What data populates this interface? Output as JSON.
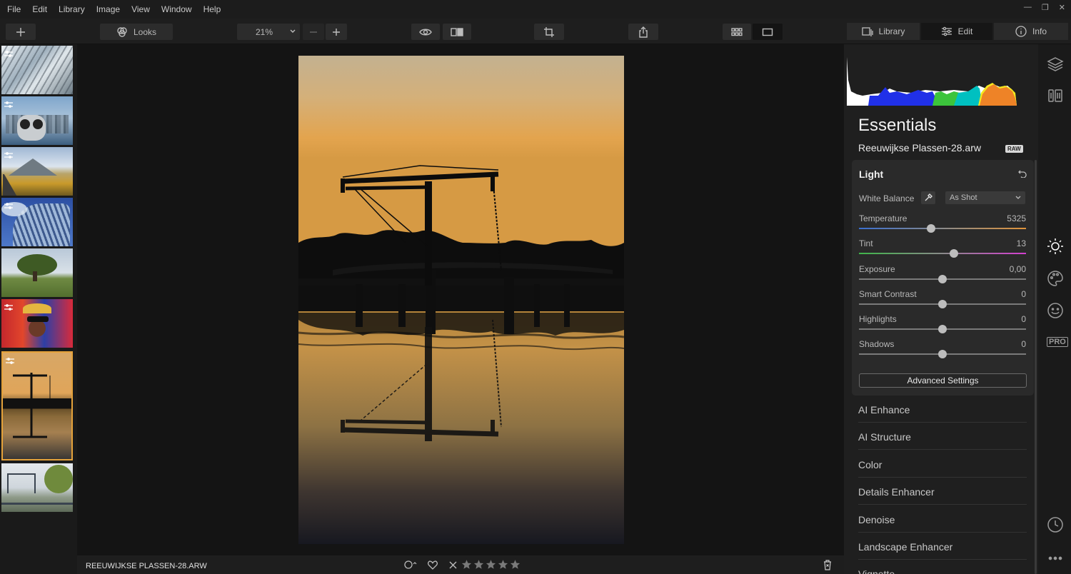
{
  "menu": [
    "File",
    "Edit",
    "Library",
    "Image",
    "View",
    "Window",
    "Help"
  ],
  "toolbar": {
    "looks_label": "Looks",
    "zoom_value": "21%"
  },
  "tabs": [
    {
      "label": "Library",
      "icon": "library-icon"
    },
    {
      "label": "Edit",
      "icon": "sliders-icon"
    },
    {
      "label": "Info",
      "icon": "info-icon"
    }
  ],
  "filmstrip": [
    {
      "subject": "architecture-lines",
      "edited": true
    },
    {
      "subject": "city-binoculars",
      "edited": true
    },
    {
      "subject": "mountain-road",
      "edited": true
    },
    {
      "subject": "glass-building",
      "edited": true
    },
    {
      "subject": "tree-field",
      "edited": false
    },
    {
      "subject": "carnival-portrait",
      "edited": true
    },
    {
      "subject": "bridge-sunset",
      "edited": true,
      "selected": true
    },
    {
      "subject": "harbor-bridge",
      "edited": false
    }
  ],
  "bottom": {
    "filename": "REEUWIJKSE PLASSEN-28.ARW",
    "rating_stars": 5
  },
  "panel": {
    "title": "Essentials",
    "file_name": "Reeuwijkse Plassen-28.arw",
    "raw_badge": "RAW",
    "light": {
      "title": "Light",
      "white_balance_label": "White Balance",
      "white_balance_value": "As Shot",
      "sliders": [
        {
          "label": "Temperature",
          "value": "5325",
          "position": 0.43
        },
        {
          "label": "Tint",
          "value": "13",
          "position": 0.57
        },
        {
          "label": "Exposure",
          "value": "0,00",
          "position": 0.5
        },
        {
          "label": "Smart Contrast",
          "value": "0",
          "position": 0.5
        },
        {
          "label": "Highlights",
          "value": "0",
          "position": 0.5
        },
        {
          "label": "Shadows",
          "value": "0",
          "position": 0.5
        }
      ],
      "advanced_label": "Advanced Settings"
    },
    "sections": [
      "AI Enhance",
      "AI Structure",
      "Color",
      "Details Enhancer",
      "Denoise",
      "Landscape Enhancer",
      "Vignette"
    ]
  },
  "colors": {
    "accent": "#e5a23a",
    "temperature_start": "#3a6fd0",
    "temperature_end": "#e0933a",
    "tint_start": "#3fb54a",
    "tint_end": "#d43fd0"
  }
}
